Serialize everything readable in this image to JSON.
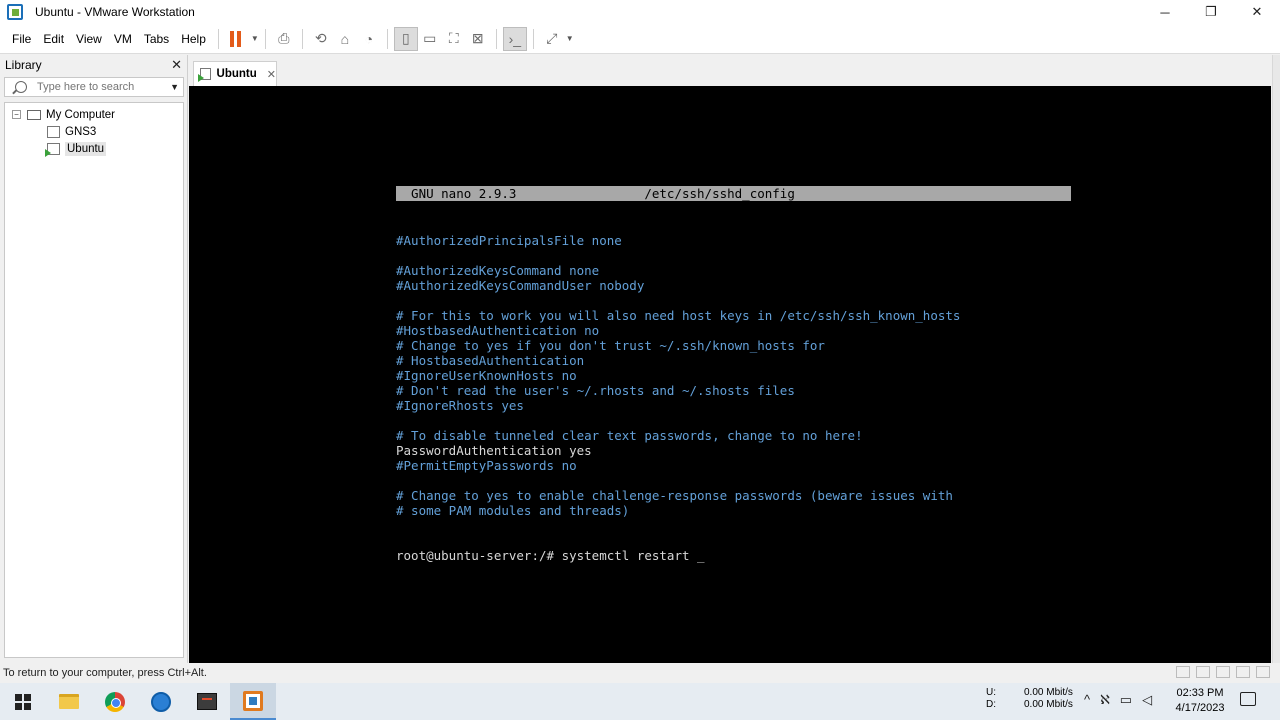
{
  "window": {
    "title": "Ubuntu - VMware Workstation",
    "minimize": "─",
    "restore": "❐",
    "close": "✕"
  },
  "menu": [
    "File",
    "Edit",
    "View",
    "VM",
    "Tabs",
    "Help"
  ],
  "library": {
    "title": "Library",
    "close": "✕",
    "search_placeholder": "Type here to search",
    "tree": {
      "root": "My Computer",
      "expander": "−",
      "children": [
        "GNS3",
        "Ubuntu"
      ]
    }
  },
  "tab": {
    "label": "Ubuntu",
    "close": "✕"
  },
  "terminal": {
    "nano_header": "  GNU nano 2.9.3                 /etc/ssh/sshd_config",
    "lines": [
      {
        "text": "#AuthorizedPrincipalsFile none",
        "style": "comment"
      },
      {
        "text": "",
        "style": "plain"
      },
      {
        "text": "#AuthorizedKeysCommand none",
        "style": "comment"
      },
      {
        "text": "#AuthorizedKeysCommandUser nobody",
        "style": "comment"
      },
      {
        "text": "",
        "style": "plain"
      },
      {
        "text": "# For this to work you will also need host keys in /etc/ssh/ssh_known_hosts",
        "style": "comment"
      },
      {
        "text": "#HostbasedAuthentication no",
        "style": "comment"
      },
      {
        "text": "# Change to yes if you don't trust ~/.ssh/known_hosts for",
        "style": "comment"
      },
      {
        "text": "# HostbasedAuthentication",
        "style": "comment"
      },
      {
        "text": "#IgnoreUserKnownHosts no",
        "style": "comment"
      },
      {
        "text": "# Don't read the user's ~/.rhosts and ~/.shosts files",
        "style": "comment"
      },
      {
        "text": "#IgnoreRhosts yes",
        "style": "comment"
      },
      {
        "text": "",
        "style": "plain"
      },
      {
        "text": "# To disable tunneled clear text passwords, change to no here!",
        "style": "comment"
      },
      {
        "text": "PasswordAuthentication yes",
        "style": "plain"
      },
      {
        "text": "#PermitEmptyPasswords no",
        "style": "comment"
      },
      {
        "text": "",
        "style": "plain"
      },
      {
        "text": "# Change to yes to enable challenge-response passwords (beware issues with",
        "style": "comment"
      },
      {
        "text": "# some PAM modules and threads)",
        "style": "comment"
      }
    ],
    "prompt": "root@ubuntu-server:/# systemctl restart _"
  },
  "status": {
    "text": "To return to your computer, press Ctrl+Alt."
  },
  "taskbar": {
    "net_upload_label": "U:",
    "net_upload_value": "0.00 Mbit/s",
    "net_download_label": "D:",
    "net_download_value": "0.00 Mbit/s",
    "time": "02:33 PM",
    "date": "4/17/2023"
  },
  "colors": {
    "comment": "#63a0d8",
    "plain": "#d8d8d8",
    "nano_bar": "#a8a8a8",
    "pause": "#e35b1a"
  }
}
